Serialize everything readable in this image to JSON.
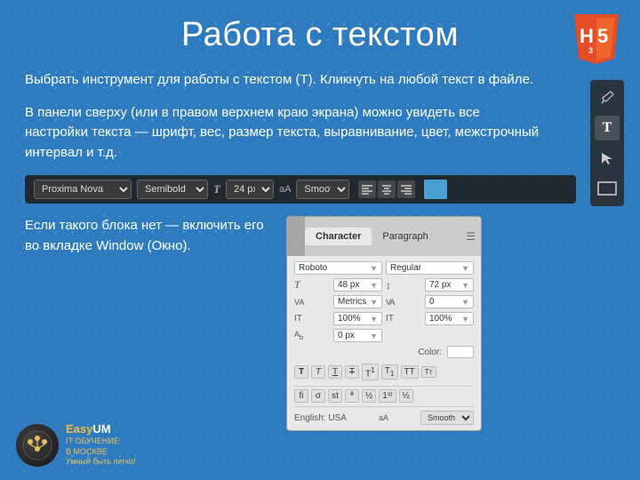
{
  "title": "Работа с текстом",
  "paragraph1": "Выбрать инструмент для работы с текстом (T). Кликнуть на любой текст в файле.",
  "paragraph2": "В панели сверху (или в правом верхнем краю экрана) можно увидеть все настройки текста — шрифт, вес, размер текста, выравнивание, цвет, межстрочный интервал и т.д.",
  "paragraph3": "Если такого блока нет — включить его во вкладке Window (Окно).",
  "toolbar": {
    "font": "Proxima Nova",
    "weight": "Semibold",
    "size": "24 px",
    "antialiasing": "Smooth"
  },
  "charPanel": {
    "tab1": "Character",
    "tab2": "Paragraph",
    "fontLabel": "Roboto",
    "styleLabel": "Regular",
    "sizeLabel": "48 px",
    "leadingLabel": "72 px",
    "kerningLabel": "Metrics",
    "trackingLabel": "0",
    "vertScaleLabel": "100%",
    "horizScaleLabel": "100%",
    "baselineLabel": "0 px",
    "colorLabel": "Color:",
    "languageLabel": "English: USA",
    "smoothLabel": "Smooth"
  },
  "logo": {
    "name": "EasyUM",
    "tagline": "IT ОБУЧЕНИЕ\nВ МОСКВЕ",
    "subtext": "Умный быть легко!"
  },
  "html5": {
    "label": "5"
  }
}
